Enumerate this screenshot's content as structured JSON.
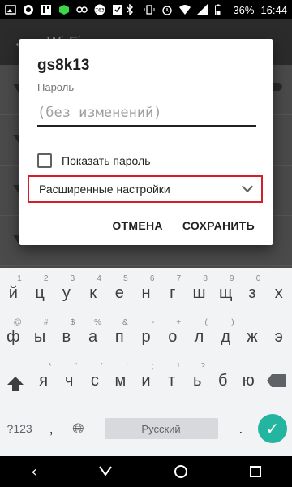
{
  "status_bar": {
    "battery": "36%",
    "time": "16:44",
    "notification_icons": [
      "image-icon",
      "chat-icon",
      "dashboard-icon",
      "cube-icon",
      "bug-icon",
      "badge-763-icon",
      "download-icon"
    ],
    "system_icons": [
      "bluetooth-icon",
      "vibrate-icon",
      "alarm-icon",
      "wifi-icon",
      "signal-icon",
      "battery-icon"
    ]
  },
  "background": {
    "title": "Wi-Fi"
  },
  "dialog": {
    "network_name": "gs8k13",
    "password_label": "Пароль",
    "password_placeholder": "(без изменений)",
    "show_password_label": "Показать пароль",
    "advanced_label": "Расширенные настройки",
    "cancel_label": "ОТМЕНА",
    "save_label": "СОХРАНИТЬ"
  },
  "keyboard": {
    "row1": [
      {
        "key": "й",
        "hint": "1"
      },
      {
        "key": "ц",
        "hint": "2"
      },
      {
        "key": "у",
        "hint": "3"
      },
      {
        "key": "к",
        "hint": "4"
      },
      {
        "key": "е",
        "hint": "5"
      },
      {
        "key": "н",
        "hint": "6"
      },
      {
        "key": "г",
        "hint": "7"
      },
      {
        "key": "ш",
        "hint": "8"
      },
      {
        "key": "щ",
        "hint": "9"
      },
      {
        "key": "з",
        "hint": "0"
      },
      {
        "key": "х",
        "hint": ""
      }
    ],
    "row2": [
      {
        "key": "ф",
        "hint": "@"
      },
      {
        "key": "ы",
        "hint": "#"
      },
      {
        "key": "в",
        "hint": "$"
      },
      {
        "key": "а",
        "hint": "%"
      },
      {
        "key": "п",
        "hint": "&"
      },
      {
        "key": "р",
        "hint": "-"
      },
      {
        "key": "о",
        "hint": "+"
      },
      {
        "key": "л",
        "hint": "("
      },
      {
        "key": "д",
        "hint": ")"
      },
      {
        "key": "ж",
        "hint": ""
      },
      {
        "key": "э",
        "hint": ""
      }
    ],
    "row3": [
      {
        "key": "я",
        "hint": "*"
      },
      {
        "key": "ч",
        "hint": "\""
      },
      {
        "key": "с",
        "hint": "'"
      },
      {
        "key": "м",
        "hint": ":"
      },
      {
        "key": "и",
        "hint": ";"
      },
      {
        "key": "т",
        "hint": "!"
      },
      {
        "key": "ь",
        "hint": "?"
      },
      {
        "key": "б",
        "hint": ""
      },
      {
        "key": "ю",
        "hint": ""
      }
    ],
    "symbols_label": "?123",
    "comma": ",",
    "space_label": "Русский",
    "period": "."
  }
}
